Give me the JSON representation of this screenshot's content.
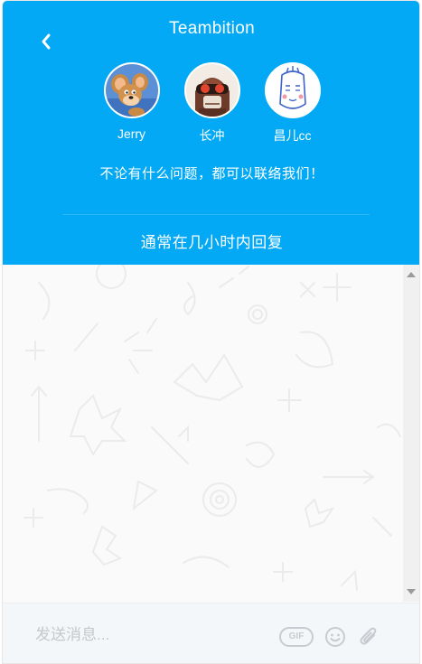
{
  "header": {
    "title": "Teambition",
    "back_icon": "chevron-left-icon",
    "background_color": "#03a9f4",
    "agents": [
      {
        "name": "Jerry",
        "avatar": "jerry-mouse-avatar"
      },
      {
        "name": "长冲",
        "avatar": "goggles-character-avatar"
      },
      {
        "name": "昌儿cc",
        "avatar": "doodle-face-avatar"
      }
    ],
    "tagline": "不论有什么问题，都可以联络我们！",
    "reply_note": "通常在几小时内回复"
  },
  "composer": {
    "placeholder": "发送消息...",
    "value": "",
    "gif_label": "GIF",
    "emoji_icon": "smiley-icon",
    "attach_icon": "paperclip-icon"
  }
}
